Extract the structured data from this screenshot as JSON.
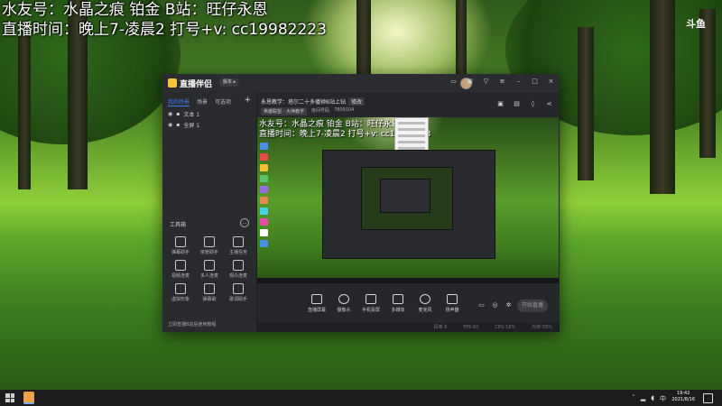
{
  "overlay": {
    "line1": "水友号：水晶之痕 铂金   B站：旺仔永恩",
    "line2": "直播时间：晚上7-凌晨2  打号+v: cc19982223"
  },
  "app": {
    "name": "直播伴侣",
    "version_pill": "版本 ▸",
    "sidebar": {
      "tabs": [
        "我的场景",
        "场景",
        "可选项"
      ],
      "sources": [
        "文本 1",
        "全屏 1"
      ],
      "tools_title": "工具箱",
      "tools": [
        {
          "label": "弹幕助手",
          "icon": "danmu-icon"
        },
        {
          "label": "房管助手",
          "icon": "admin-icon"
        },
        {
          "label": "主播任务",
          "icon": "task-icon"
        },
        {
          "label": "视频连麦",
          "icon": "video-link-icon"
        },
        {
          "label": "多人连麦",
          "icon": "multi-link-icon"
        },
        {
          "label": "观众连麦",
          "icon": "audience-link-icon"
        },
        {
          "label": "虚拟形象",
          "icon": "avatar-icon"
        },
        {
          "label": "弹幕歌",
          "icon": "song-icon"
        },
        {
          "label": "歌词助手",
          "icon": "lyrics-icon"
        }
      ],
      "bottom_hint": "立即直播B站后使用教程"
    },
    "room": {
      "title": "永恩教学：塔尔二十多播钟B站上钻",
      "tag": "修改",
      "category": "英雄联盟 - 大神教学",
      "room_label": "房间号码",
      "room_id": "7809104"
    },
    "controls": [
      "直播屏幕",
      "摄像头",
      "手机投屏",
      "多媒体",
      "麦克风",
      "扬声器"
    ],
    "start_button": "开始直播",
    "status": [
      "码率 0",
      "FPS 60",
      "CPU 18%",
      "内存 55%"
    ]
  },
  "taskbar": {
    "time": "19:42",
    "date": "2021/8/16",
    "input": "中"
  },
  "corner_logo": "斗鱼"
}
